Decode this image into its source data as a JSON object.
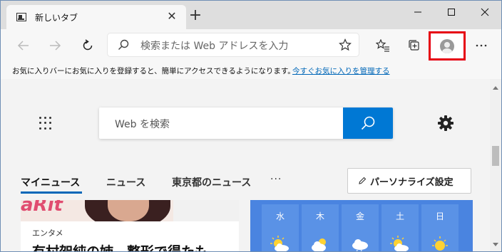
{
  "tab": {
    "title": "新しいタブ",
    "close": "✕"
  },
  "newtab_glyph": "+",
  "window": {
    "minimize": "minimize",
    "maximize": "maximize",
    "close": "close"
  },
  "address_bar": {
    "placeholder": "検索または Web アドレスを入力"
  },
  "favorites_bar": {
    "message": "お気に入りバーにお気に入りを登録すると、簡単にアクセスできるようになります。",
    "link": "今すぐお気に入りを管理する"
  },
  "search": {
    "placeholder": "Web を検索"
  },
  "news": {
    "tabs": [
      "マイニュース",
      "ニュース",
      "東京都のニュース"
    ],
    "active_tab": 0,
    "more": "···",
    "personalize": "パーソナライズ設定"
  },
  "card": {
    "image_logo": "aRit",
    "category": "エンタメ",
    "headline": "有村架純の姉　整形で得たも"
  },
  "weather": {
    "days": [
      "水",
      "木",
      "金",
      "土",
      "日"
    ],
    "icons": [
      "partly-sunny-icon",
      "partly-cloudy-icon",
      "cloudy-rain-icon",
      "partly-sunny-icon",
      "sunny-icon"
    ]
  },
  "colors": {
    "accent": "#0078d4",
    "link": "#0067b8",
    "highlight_box": "#e60012",
    "weather_bg": "#4a84e0"
  }
}
